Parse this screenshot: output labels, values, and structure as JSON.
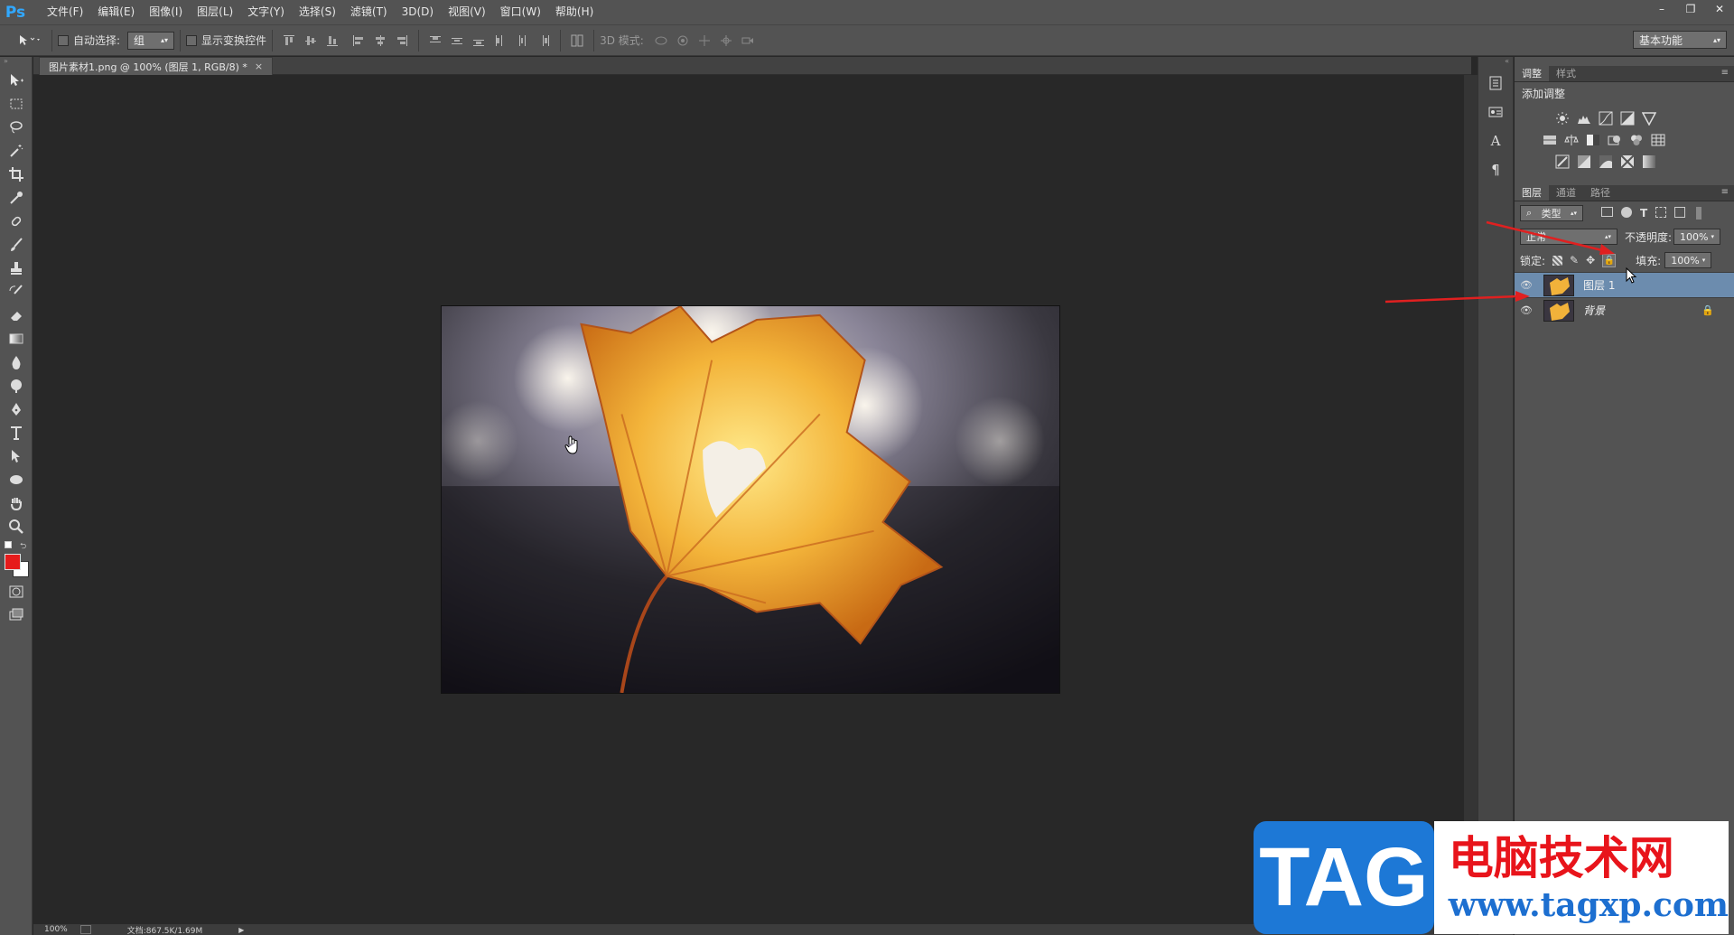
{
  "app": {
    "logo": "Ps",
    "menu": [
      "文件(F)",
      "编辑(E)",
      "图像(I)",
      "图层(L)",
      "文字(Y)",
      "选择(S)",
      "滤镜(T)",
      "3D(D)",
      "视图(V)",
      "窗口(W)",
      "帮助(H)"
    ],
    "window_controls": [
      "–",
      "❐",
      "✕"
    ]
  },
  "options": {
    "auto_select_label": "自动选择:",
    "auto_select_value": "组",
    "show_transform_label": "显示变换控件",
    "mode_3d_label": "3D 模式:",
    "workspace": "基本功能"
  },
  "document": {
    "tab_title": "图片素材1.png @ 100% (图层 1, RGB/8) *",
    "tab_close": "×"
  },
  "status": {
    "zoom": "100%",
    "doc_info": "文档:867.5K/1.69M"
  },
  "adjustments": {
    "tabs": [
      "调整",
      "样式"
    ],
    "title": "添加调整"
  },
  "layers_panel": {
    "tabs": [
      "图层",
      "通道",
      "路径"
    ],
    "filter_kind": "类型",
    "blend_mode": "正常",
    "opacity_label": "不透明度:",
    "opacity_value": "100%",
    "lock_label": "锁定:",
    "fill_label": "填充:",
    "fill_value": "100%",
    "layers": [
      {
        "name": "图层 1",
        "selected": true
      },
      {
        "name": "背景",
        "selected": false,
        "locked": true
      }
    ]
  },
  "watermark": {
    "tag": "TAG",
    "cn": "电脑技术网",
    "url": "www.tagxp.com"
  },
  "colors": {
    "foreground": "#e61b1b",
    "background": "#ffffff",
    "selection": "#6c8cae",
    "annotation_arrow": "#e02020"
  }
}
